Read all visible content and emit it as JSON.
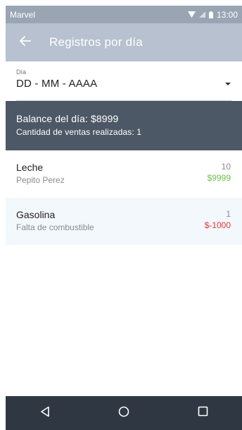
{
  "status_bar": {
    "carrier": "Marvel",
    "time": "13:00"
  },
  "app_bar": {
    "title": "Registros por día",
    "back_icon": "arrow-left-icon"
  },
  "date_field": {
    "label": "Día",
    "value": "DD - MM - AAAA"
  },
  "balance": {
    "balance_text": "Balance del día: $8999",
    "count_text": "Cantidad de ventas realizadas:  1"
  },
  "sales": [
    {
      "name": "Leche",
      "description": "Pepito Perez",
      "quantity": "10",
      "amount": "$9999",
      "amount_color": "#6cc04a"
    },
    {
      "name": "Gasolina",
      "description": "Falta de combustible",
      "quantity": "1",
      "amount": "$-1000",
      "amount_color": "#e53935"
    }
  ],
  "colors": {
    "status_bar": "#9aa5b4",
    "app_bar": "#b7c1cf",
    "balance_panel": "#4d5866",
    "nav_bar": "#2f3842"
  },
  "nav_bar": {
    "icons": [
      "back-triangle-icon",
      "home-circle-icon",
      "recents-square-icon"
    ]
  }
}
